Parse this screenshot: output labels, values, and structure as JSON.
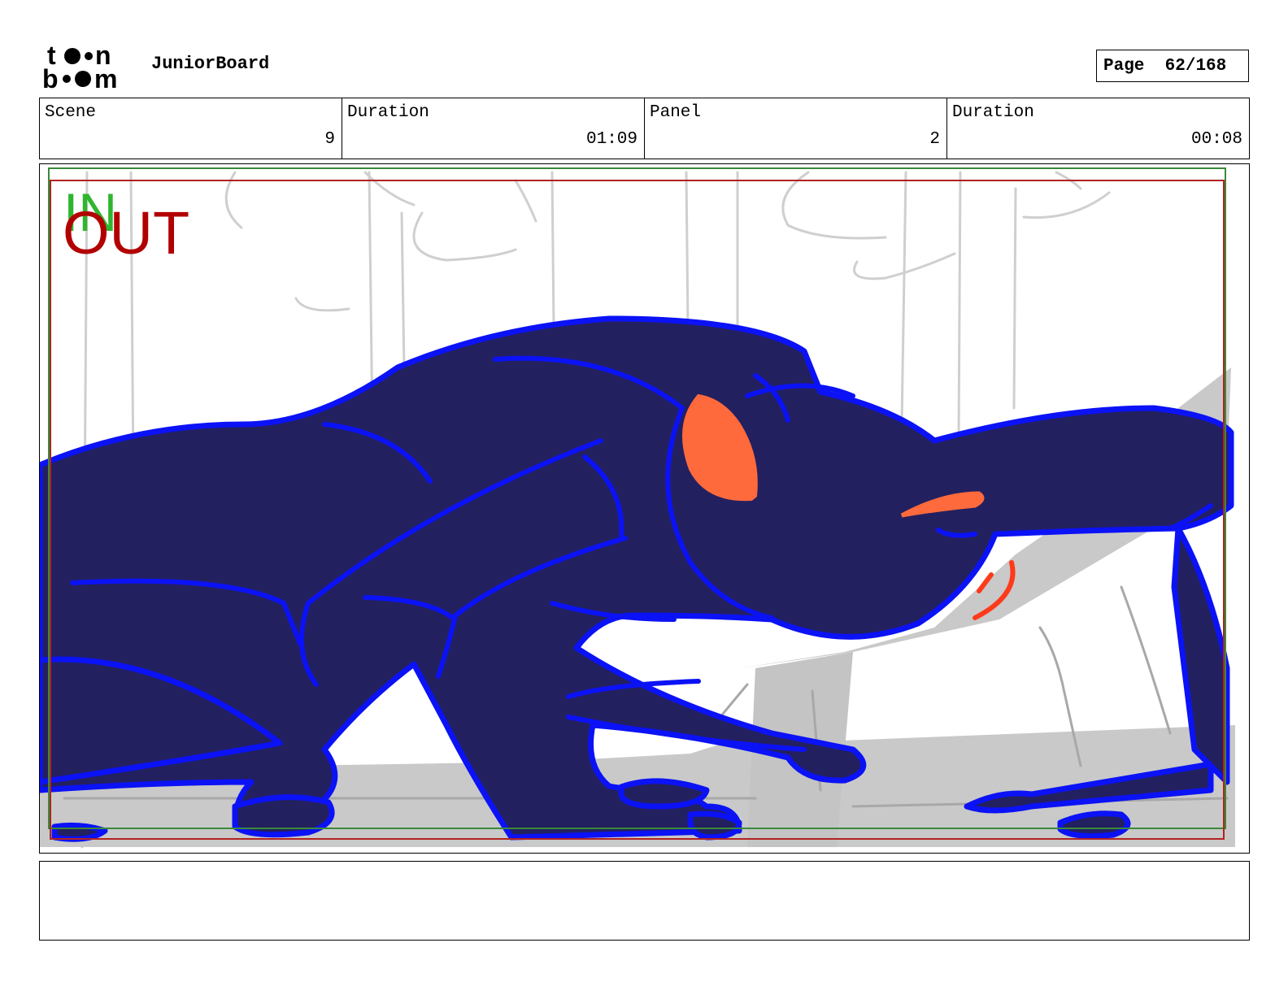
{
  "header": {
    "logo_text_top": "toon",
    "logo_text_bottom": "boom",
    "app_name": "JuniorBoard",
    "page_label": "Page",
    "page_value": "62/168"
  },
  "info": {
    "scene_label": "Scene",
    "scene_value": "9",
    "scene_duration_label": "Duration",
    "scene_duration_value": "01:09",
    "panel_label": "Panel",
    "panel_value": "2",
    "panel_duration_label": "Duration",
    "panel_duration_value": "00:08"
  },
  "panel": {
    "in_marker": "IN",
    "out_marker": "OUT",
    "colors": {
      "figure_fill": "#23205f",
      "figure_outline": "#0b12f5",
      "accent": "#ff6a3c",
      "rock": "#c9c9c9",
      "sketch": "#cfcfcf",
      "safe_green": "#3a8a3a",
      "safe_red": "#b22222"
    }
  },
  "notes": {
    "text": ""
  }
}
